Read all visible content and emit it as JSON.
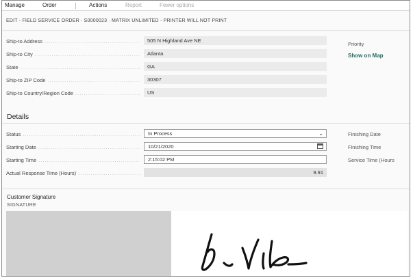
{
  "menu": {
    "manage": "Manage",
    "order": "Order",
    "actions": "Actions",
    "report": "Report",
    "fewer_options": "Fewer options"
  },
  "page_title": "EDIT - FIELD SERVICE ORDER - S0000023 · MATRIX UNLIMITED - PRINTER WILL NOT PRINT",
  "ship_to": {
    "address": {
      "label": "Ship-to Address",
      "value": "505 N Highland Ave NE"
    },
    "city": {
      "label": "Ship-to City",
      "value": "Atlanta"
    },
    "state": {
      "label": "State",
      "value": "GA"
    },
    "zip": {
      "label": "Ship-to ZIP Code",
      "value": "30307"
    },
    "country": {
      "label": "Ship-to Country/Region Code",
      "value": "US"
    }
  },
  "right_col": {
    "priority": "Priority",
    "show_on_map": "Show on Map",
    "finishing_date": "Finishing Date",
    "finishing_time": "Finishing Time",
    "service_time": "Service Time (Hours"
  },
  "details": {
    "heading": "Details",
    "status": {
      "label": "Status",
      "value": "In Process"
    },
    "starting_date": {
      "label": "Starting Date",
      "value": "10/21/2020"
    },
    "starting_time": {
      "label": "Starting Time",
      "value": "2:15:02 PM"
    },
    "response_time": {
      "label": "Actual Response Time (Hours)",
      "value": "9.91"
    }
  },
  "signature": {
    "heading": "Customer Signature",
    "sublabel": "SIGNATURE"
  },
  "icons": {
    "status_dropdown": "chevron-down-icon",
    "date_picker": "calendar-icon"
  },
  "colors": {
    "link": "#1b6b5e",
    "field_bg": "#ebebeb",
    "signature_ink": "#111111"
  }
}
